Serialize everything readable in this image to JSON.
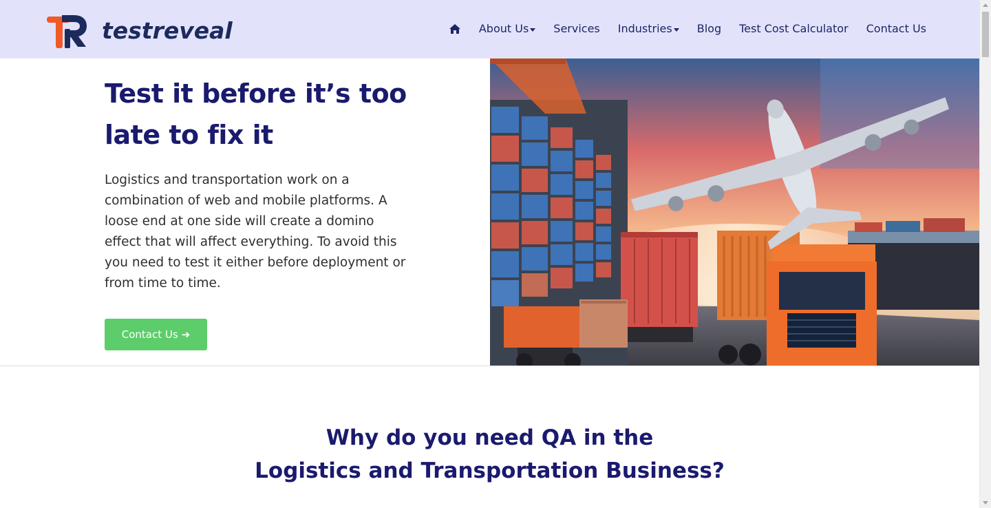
{
  "header": {
    "logo_text": "testreveal",
    "nav": [
      {
        "label": "About Us",
        "dropdown": true
      },
      {
        "label": "Services",
        "dropdown": false
      },
      {
        "label": "Industries",
        "dropdown": true
      },
      {
        "label": "Blog",
        "dropdown": false
      },
      {
        "label": "Test Cost Calculator",
        "dropdown": false
      },
      {
        "label": "Contact Us",
        "dropdown": false
      }
    ],
    "home_icon": "home-icon"
  },
  "hero": {
    "title": "Test it before it’s too late to fix it",
    "text": "Logistics and transportation work on a combination of web and mobile platforms. A loose end at one side will create a domino effect that will affect everything. To avoid this you need to test it either before deployment or from time to time.",
    "cta_label": "Contact Us",
    "cta_icon": "arrow-right-icon"
  },
  "section": {
    "title_line1": "Why do you need QA in the",
    "title_line2": "Logistics and Transportation Business?"
  },
  "colors": {
    "header_bg": "#e2e3fb",
    "nav_text": "#1e2466",
    "heading": "#1a1a6e",
    "cta_bg": "#5ccd6a",
    "logo_orange": "#f05a28",
    "logo_navy": "#1d2a5c"
  }
}
